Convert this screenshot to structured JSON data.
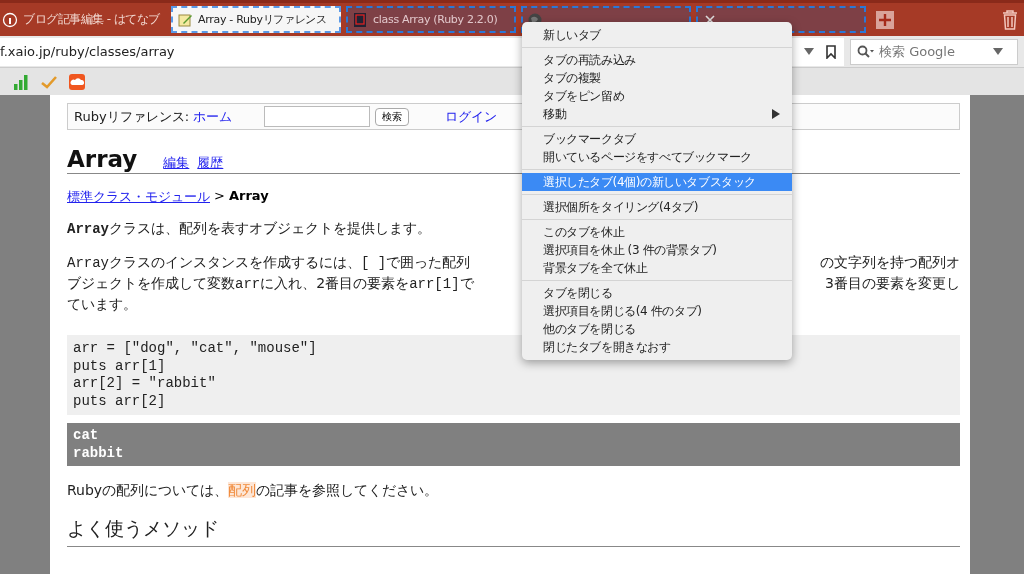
{
  "tabs": [
    {
      "title": "ブログ記事編集 - はてなブ",
      "selected": false,
      "active": false
    },
    {
      "title": "Array - Rubyリファレンス",
      "selected": true,
      "active": true
    },
    {
      "title": "class Array (Ruby 2.2.0)",
      "selected": true,
      "active": false
    },
    {
      "selected": true,
      "active": false
    },
    {
      "selected": true,
      "active": false
    }
  ],
  "url": "f.xaio.jp/ruby/classes/array",
  "search": {
    "placeholder": "検索 Google"
  },
  "page": {
    "header": {
      "label": "Rubyリファレンス:",
      "home_link": "ホーム",
      "search_button": "検索",
      "login_link": "ログイン"
    },
    "title": "Array",
    "title_links": [
      "編集",
      "履歴"
    ],
    "breadcrumb": {
      "link": "標準クラス・モジュール",
      "separator": ">",
      "current": "Array"
    },
    "intro": [
      {
        "kind": "code",
        "text": "Array"
      },
      {
        "kind": "text",
        "text": "クラスは、配列を表すオブジェクトを提供します。"
      }
    ],
    "paragraph_lines": [
      {
        "left": [
          {
            "kind": "code",
            "text": "Array"
          },
          {
            "kind": "text",
            "text": "クラスのインスタンスを作成するには、"
          },
          {
            "kind": "code",
            "text": "[ ]"
          },
          {
            "kind": "text",
            "text": "で囲った配列"
          }
        ],
        "right": "の文字列を持つ配列オ"
      },
      {
        "left": [
          {
            "kind": "text",
            "text": "ブジェクトを作成して変数"
          },
          {
            "kind": "code",
            "text": "arr"
          },
          {
            "kind": "text",
            "text": "に入れ、2番目の要素を"
          },
          {
            "kind": "code",
            "text": "arr[1]"
          },
          {
            "kind": "text",
            "text": "で"
          }
        ],
        "right": "3番目の要素を変更し"
      },
      {
        "left": [
          {
            "kind": "text",
            "text": "ています。"
          }
        ]
      }
    ],
    "code": [
      "arr = [\"dog\", \"cat\", \"mouse\"]",
      "puts arr[1]",
      "arr[2] = \"rabbit\"",
      "puts arr[2]"
    ],
    "output": [
      "cat",
      "rabbit"
    ],
    "note": {
      "before": "Rubyの配列については、",
      "link": "配列",
      "after": "の記事を参照してください。"
    },
    "heading": "よく使うメソッド"
  },
  "context_menu": [
    {
      "items": [
        {
          "label": "新しいタブ",
          "selected": false,
          "submenu": false
        }
      ]
    },
    {
      "items": [
        {
          "label": "タブの再読み込み",
          "selected": false,
          "submenu": false
        },
        {
          "label": "タブの複製",
          "selected": false,
          "submenu": false
        },
        {
          "label": "タブをピン留め",
          "selected": false,
          "submenu": false
        },
        {
          "label": "移動",
          "selected": false,
          "submenu": true
        }
      ]
    },
    {
      "items": [
        {
          "label": "ブックマークタブ",
          "selected": false,
          "submenu": false
        },
        {
          "label": "開いているページをすべてブックマーク",
          "selected": false,
          "submenu": false
        }
      ]
    },
    {
      "items": [
        {
          "label": "選択したタブ(4個)の新しいタブスタック",
          "selected": true,
          "submenu": false
        }
      ]
    },
    {
      "items": [
        {
          "label": "選択個所をタイリング(4タブ)",
          "selected": false,
          "submenu": false
        }
      ]
    },
    {
      "items": [
        {
          "label": "このタブを休止",
          "selected": false,
          "submenu": false
        },
        {
          "label": "選択項目を休止 (3 件の背景タブ)",
          "selected": false,
          "submenu": false
        },
        {
          "label": "背景タブを全て休止",
          "selected": false,
          "submenu": false
        }
      ]
    },
    {
      "items": [
        {
          "label": "タブを閉じる",
          "selected": false,
          "submenu": false
        },
        {
          "label": "選択項目を閉じる(4 件のタブ)",
          "selected": false,
          "submenu": false
        },
        {
          "label": "他のタブを閉じる",
          "selected": false,
          "submenu": false
        },
        {
          "label": "閉じたタブを開きなおす",
          "selected": false,
          "submenu": false
        }
      ]
    }
  ]
}
